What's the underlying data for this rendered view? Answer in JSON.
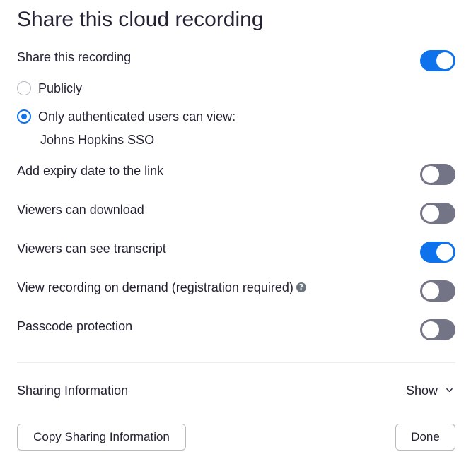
{
  "dialog": {
    "title": "Share this cloud recording"
  },
  "share_recording": {
    "label": "Share this recording",
    "enabled": true
  },
  "visibility": {
    "options": [
      {
        "label": "Publicly",
        "selected": false
      },
      {
        "label": "Only authenticated users can view:",
        "selected": true
      }
    ],
    "auth_provider": "Johns Hopkins SSO"
  },
  "settings": [
    {
      "label": "Add expiry date to the link",
      "enabled": false
    },
    {
      "label": "Viewers can download",
      "enabled": false
    },
    {
      "label": "Viewers can see transcript",
      "enabled": true
    },
    {
      "label": "View recording on demand (registration required)",
      "enabled": false,
      "help_icon": "question-circle-icon"
    },
    {
      "label": "Passcode protection",
      "enabled": false
    }
  ],
  "sharing_info": {
    "label": "Sharing Information",
    "toggle_label": "Show"
  },
  "buttons": {
    "copy_label": "Copy Sharing Information",
    "done_label": "Done"
  },
  "colors": {
    "accent": "#0e72ed",
    "toggle_off": "#747487",
    "text": "#232333"
  }
}
